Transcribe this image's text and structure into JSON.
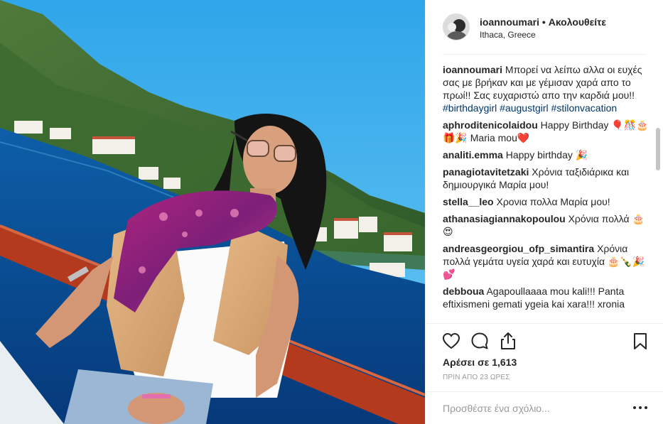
{
  "post": {
    "username": "ioannoumari",
    "separator": "•",
    "follow_status": "Ακολουθείτε",
    "location": "Ithaca, Greece",
    "likes_text": "Αρέσει σε 1,613",
    "timestamp": "ΠΡΙΝ ΑΠΟ 23 ΩΡΕΣ"
  },
  "caption": {
    "user": "ioannoumari",
    "text": "Μπορεί να λείπω αλλα οι ευχές σας με βρήκαν και με γέμισαν χαρά απο το πρωί!! Σας ευχαριστώ απο την καρδιά μου!!",
    "hashtags": [
      "#birthdaygirl",
      "#augustgirl",
      "#stilonvacation"
    ]
  },
  "comments": [
    {
      "user": "aphroditenicolaidou",
      "text": "Happy Birthday 🎈🎊🎂🎁🎉 Maria mou❤️"
    },
    {
      "user": "analiti.emma",
      "text": "Happy birthday 🎉"
    },
    {
      "user": "panagiotavitetzaki",
      "text": "Χρόνια ταξιδιάρικα και δημιουργικά Μαρία μου!"
    },
    {
      "user": "stella__leo",
      "text": "Χρονια πολλα Μαρία μου!"
    },
    {
      "user": "athanasiagiannakopoulou",
      "text": "Χρόνια πολλά 🎂😍"
    },
    {
      "user": "andreasgeorgiou_ofp_simantira",
      "text": "Χρόνια πολλά γεμάτα υγεία χαρά και ευτυχία 🎂🍾🎉💕"
    },
    {
      "user": "debboua",
      "text": "Agapoullaaaa mou kali!!! Panta eftixismeni gemati ygeia kai xara!!! xronia"
    }
  ],
  "actions": {
    "like_icon": "heart-icon",
    "comment_icon": "comment-icon",
    "share_icon": "share-icon",
    "save_icon": "bookmark-icon"
  },
  "add_comment": {
    "placeholder": "Προσθέστε ένα σχόλιο...",
    "options_icon": "more-options-icon"
  },
  "colors": {
    "text": "#262626",
    "hashtag": "#003569",
    "muted": "#999999",
    "divider": "#efefef"
  }
}
